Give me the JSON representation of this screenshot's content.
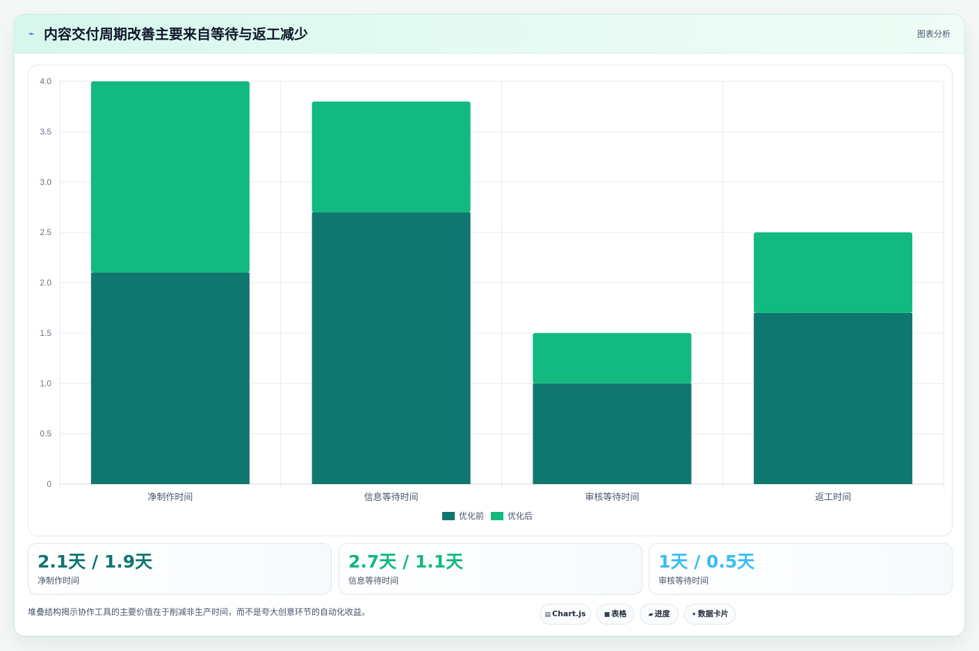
{
  "header": {
    "title": "内容交付周期改善主要来自等待与返工减少",
    "tag": "图表分析"
  },
  "colors": {
    "before": "#10776e",
    "after": "#12b981",
    "stat1": "#0f766e",
    "stat2": "#10b981",
    "stat3": "#38bdf8"
  },
  "chart_data": {
    "type": "bar",
    "stacked": true,
    "categories": [
      "净制作时间",
      "信息等待时间",
      "审核等待时间",
      "返工时间"
    ],
    "series": [
      {
        "name": "优化前",
        "values": [
          2.1,
          2.7,
          1.0,
          1.7
        ]
      },
      {
        "name": "优化后",
        "values": [
          1.9,
          1.1,
          0.5,
          0.8
        ]
      }
    ],
    "ylim": [
      0,
      4.0
    ],
    "yticks": [
      "0",
      "0.5",
      "1.0",
      "1.5",
      "2.0",
      "2.5",
      "3.0",
      "3.5",
      "4.0"
    ],
    "ytick_values": [
      0,
      0.5,
      1.0,
      1.5,
      2.0,
      2.5,
      3.0,
      3.5,
      4.0
    ],
    "legend_position": "bottom-center",
    "grid": true
  },
  "stats": [
    {
      "value": "2.1天 / 1.9天",
      "label": "净制作时间"
    },
    {
      "value": "2.7天 / 1.1天",
      "label": "信息等待时间"
    },
    {
      "value": "1天 / 0.5天",
      "label": "审核等待时间"
    }
  ],
  "footnote": "堆叠结构揭示协作工具的主要价值在于削减非生产时间，而不是夸大创意环节的自动化收益。",
  "chips": [
    {
      "icon": "chart-icon",
      "label": "Chart.js"
    },
    {
      "icon": "table-icon",
      "label": "表格"
    },
    {
      "icon": "progress-icon",
      "label": "进度"
    },
    {
      "icon": "sparkle-icon",
      "label": "数据卡片"
    }
  ]
}
